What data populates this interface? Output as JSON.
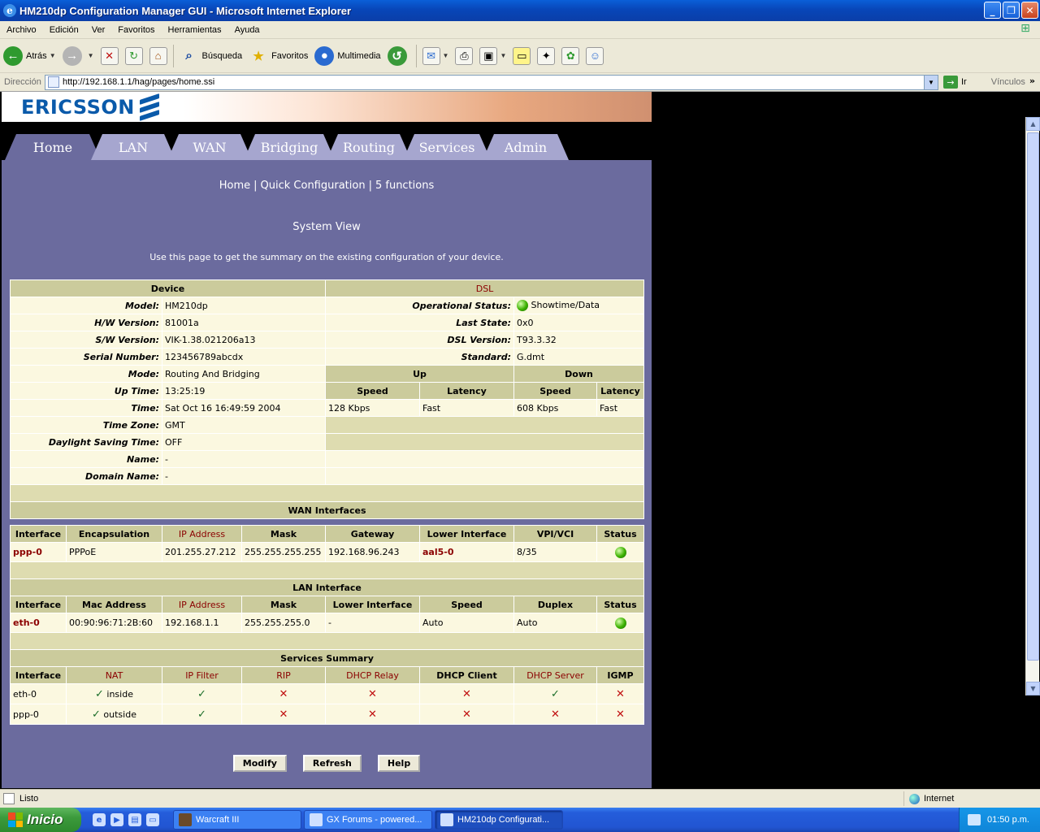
{
  "window": {
    "title": "HM210dp Configuration Manager GUI - Microsoft Internet Explorer"
  },
  "menu": [
    "Archivo",
    "Edición",
    "Ver",
    "Favoritos",
    "Herramientas",
    "Ayuda"
  ],
  "toolbar": {
    "back": "Atrás",
    "search": "Búsqueda",
    "favorites": "Favoritos",
    "media": "Multimedia"
  },
  "address": {
    "label": "Dirección",
    "url": "http://192.168.1.1/hag/pages/home.ssi",
    "go": "Ir",
    "links": "Vínculos"
  },
  "brand": {
    "logo": "ERICSSON"
  },
  "tabs": [
    "Home",
    "LAN",
    "WAN",
    "Bridging",
    "Routing",
    "Services",
    "Admin"
  ],
  "subnav": [
    "Home",
    "Quick Configuration",
    "5 functions"
  ],
  "page": {
    "title": "System View",
    "description": "Use this page to get the summary on the existing configuration of your device."
  },
  "device": {
    "header": "Device",
    "rows": [
      {
        "label": "Model:",
        "value": "HM210dp"
      },
      {
        "label": "H/W Version:",
        "value": "81001a"
      },
      {
        "label": "S/W Version:",
        "value": "VIK-1.38.021206a13"
      },
      {
        "label": "Serial Number:",
        "value": "123456789abcdx"
      },
      {
        "label": "Mode:",
        "value": "Routing And Bridging"
      },
      {
        "label": "Up Time:",
        "value": "13:25:19"
      },
      {
        "label": "Time:",
        "value": "Sat Oct 16 16:49:59 2004"
      },
      {
        "label": "Time Zone:",
        "value": "GMT"
      },
      {
        "label": "Daylight Saving Time:",
        "value": "OFF"
      },
      {
        "label": "Name:",
        "value": "-"
      },
      {
        "label": "Domain Name:",
        "value": "-"
      }
    ]
  },
  "dsl": {
    "header": "DSL",
    "rows": [
      {
        "label": "Operational Status:",
        "value": "Showtime/Data"
      },
      {
        "label": "Last State:",
        "value": "0x0"
      },
      {
        "label": "DSL Version:",
        "value": "T93.3.32"
      },
      {
        "label": "Standard:",
        "value": "G.dmt"
      }
    ],
    "up": "Up",
    "down": "Down",
    "speed": "Speed",
    "latency": "Latency",
    "up_speed": "128 Kbps",
    "up_latency": "Fast",
    "down_speed": "608 Kbps",
    "down_latency": "Fast"
  },
  "wan": {
    "title": "WAN Interfaces",
    "headers": [
      "Interface",
      "Encapsulation",
      "IP Address",
      "Mask",
      "Gateway",
      "Lower Interface",
      "VPI/VCI",
      "Status"
    ],
    "row": [
      "ppp-0",
      "PPPoE",
      "201.255.27.212",
      "255.255.255.255",
      "192.168.96.243",
      "aal5-0",
      "8/35"
    ]
  },
  "lan": {
    "title": "LAN Interface",
    "headers": [
      "Interface",
      "Mac Address",
      "IP Address",
      "Mask",
      "Lower Interface",
      "Speed",
      "Duplex",
      "Status"
    ],
    "row": [
      "eth-0",
      "00:90:96:71:2B:60",
      "192.168.1.1",
      "255.255.255.0",
      "-",
      "Auto",
      "Auto"
    ]
  },
  "services": {
    "title": "Services Summary",
    "headers": [
      "Interface",
      "NAT",
      "IP Filter",
      "RIP",
      "DHCP Relay",
      "DHCP Client",
      "DHCP Server",
      "IGMP"
    ],
    "rows": [
      {
        "iface": "eth-0",
        "nat": "inside"
      },
      {
        "iface": "ppp-0",
        "nat": "outside"
      }
    ]
  },
  "buttons": {
    "modify": "Modify",
    "refresh": "Refresh",
    "help": "Help"
  },
  "status": {
    "text": "Listo",
    "zone": "Internet"
  },
  "taskbar": {
    "start": "Inicio",
    "tasks": [
      "Warcraft III",
      "GX Forums - powered...",
      "HM210dp Configurati..."
    ],
    "clock": "01:50 p.m."
  },
  "colors": {
    "page_bg": "#6b6b9e",
    "header_bg": "#cbcb9c",
    "cell_bg": "#fbf8e0",
    "accent_red": "#8b0000"
  }
}
